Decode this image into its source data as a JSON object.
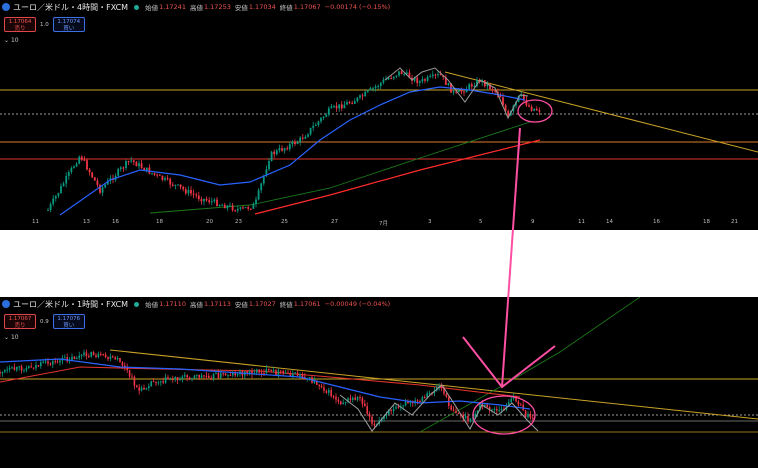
{
  "top_chart": {
    "symbol": "ユーロ／米ドル・4時間・FXCM",
    "open_label": "始値",
    "open": "1.17241",
    "high_label": "高値",
    "high": "1.17253",
    "low_label": "安値",
    "low": "1.17034",
    "close_label": "終値",
    "close": "1.17067",
    "change": "−0.00174 (−0.15%)",
    "sell_price": "1.17064",
    "sell_label": "売り",
    "spread": "1.0",
    "buy_price": "1.17074",
    "buy_label": "買い",
    "volume_label": "10",
    "x_ticks": [
      "11",
      "13",
      "16",
      "18",
      "20",
      "23",
      "25",
      "27",
      "7月",
      "3",
      "5",
      "9",
      "11",
      "14",
      "16",
      "18",
      "21"
    ],
    "colors": {
      "up": "#089981",
      "down": "#f23645",
      "ma_fast": "#2962ff",
      "ma_mid": "#1b7a1b",
      "ma_slow": "#ff2b2b",
      "level": "#c9a227"
    }
  },
  "bottom_chart": {
    "symbol": "ユーロ／米ドル・1時間・FXCM",
    "open_label": "始値",
    "open": "1.17110",
    "high_label": "高値",
    "high": "1.17113",
    "low_label": "安値",
    "low": "1.17027",
    "close_label": "終値",
    "close": "1.17061",
    "change": "−0.00049 (−0.04%)",
    "sell_price": "1.17067",
    "sell_label": "売り",
    "spread": "0.9",
    "buy_price": "1.17076",
    "buy_label": "買い",
    "volume_label": "10"
  },
  "annotation_color": "#ff4fa3"
}
